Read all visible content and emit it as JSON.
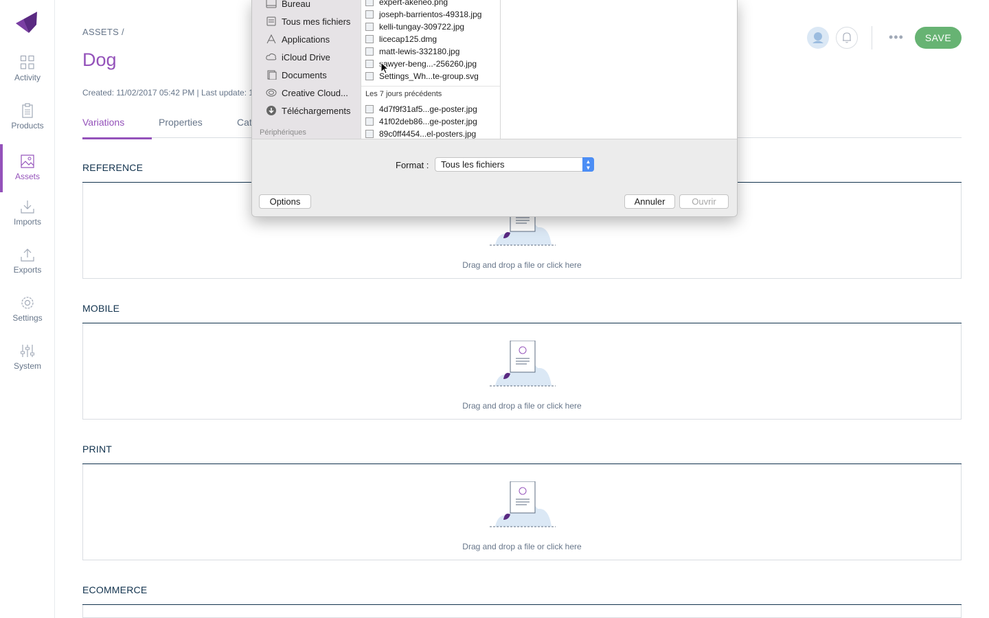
{
  "colors": {
    "accent": "#9452ba",
    "save": "#67b373",
    "text": "#67768a",
    "dark": "#11324d"
  },
  "sidebar": {
    "items": [
      {
        "label": "Activity",
        "icon": "grid-icon"
      },
      {
        "label": "Products",
        "icon": "clipboard-icon"
      },
      {
        "label": "Assets",
        "icon": "image-icon",
        "active": true
      },
      {
        "label": "Imports",
        "icon": "download-icon"
      },
      {
        "label": "Exports",
        "icon": "upload-icon"
      },
      {
        "label": "Settings",
        "icon": "gear-icon"
      },
      {
        "label": "System",
        "icon": "sliders-icon"
      }
    ]
  },
  "header": {
    "breadcrumb": "ASSETS /",
    "title": "Dog",
    "meta": "Created: 11/02/2017 05:42 PM | Last update: 1",
    "save_label": "SAVE",
    "more_label": "•••"
  },
  "tabs": [
    {
      "label": "Variations",
      "active": true
    },
    {
      "label": "Properties"
    },
    {
      "label": "Categories"
    }
  ],
  "sections": [
    {
      "title": "REFERENCE",
      "dropzone_text": "Drag and drop a file or click here"
    },
    {
      "title": "MOBILE",
      "dropzone_text": "Drag and drop a file or click here"
    },
    {
      "title": "PRINT",
      "dropzone_text": "Drag and drop a file or click here"
    },
    {
      "title": "ECOMMERCE",
      "dropzone_text": ""
    }
  ],
  "dialog": {
    "sidebar_items": [
      {
        "label": "Bureau",
        "icon": "desktop-icon"
      },
      {
        "label": "Tous mes fichiers",
        "icon": "all-files-icon"
      },
      {
        "label": "Applications",
        "icon": "applications-icon"
      },
      {
        "label": "iCloud Drive",
        "icon": "cloud-icon"
      },
      {
        "label": "Documents",
        "icon": "documents-icon"
      },
      {
        "label": "Creative Cloud...",
        "icon": "creative-cloud-icon"
      },
      {
        "label": "Téléchargements",
        "icon": "downloads-icon"
      }
    ],
    "sidebar_heading": "Périphériques",
    "files_recent": [
      "expert-akeneo.png",
      "joseph-barrientos-49318.jpg",
      "kelli-tungay-309722.jpg",
      "licecap125.dmg",
      "matt-lewis-332180.jpg",
      "sawyer-beng...-256260.jpg",
      "Settings_Wh...te-group.svg"
    ],
    "group_label": "Les 7 jours précédents",
    "files_week": [
      "4d7f9f31af5...ge-poster.jpg",
      "41f02deb86...ge-poster.jpg",
      "89c0ff4454...el-posters.jpg"
    ],
    "format_label": "Format :",
    "format_value": "Tous les fichiers",
    "options_label": "Options",
    "cancel_label": "Annuler",
    "open_label": "Ouvrir"
  }
}
